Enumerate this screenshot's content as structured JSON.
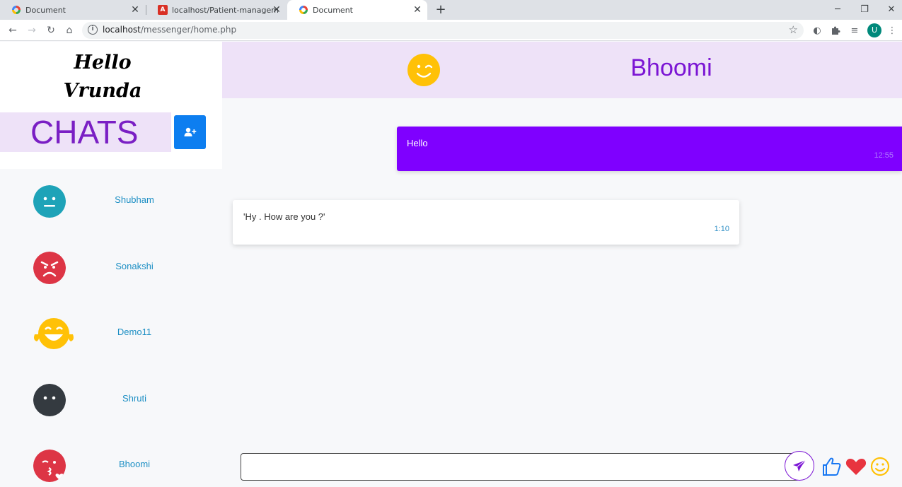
{
  "browser": {
    "tabs": [
      {
        "title": "Document"
      },
      {
        "title": "localhost/Patient-management-s"
      },
      {
        "title": "Document"
      }
    ],
    "url_host": "localhost",
    "url_path": "/messenger/home.php",
    "profile_initial": "U"
  },
  "sidebar": {
    "greeting_line1": "Hello",
    "greeting_line2": "Vrunda",
    "chats_title": "CHATS",
    "contacts": [
      {
        "name": "Shubham",
        "emoji": "neutral-face-icon",
        "color": "#1ea3b8"
      },
      {
        "name": "Sonakshi",
        "emoji": "angry-face-icon",
        "color": "#dd3545"
      },
      {
        "name": "Demo11",
        "emoji": "tears-of-joy-icon",
        "color": "#ffc107"
      },
      {
        "name": "Shruti",
        "emoji": "no-mouth-face-icon",
        "color": "#343a40"
      },
      {
        "name": "Bhoomi",
        "emoji": "kissing-face-icon",
        "color": "#dd3545"
      }
    ]
  },
  "chat": {
    "contact_name": "Bhoomi",
    "header_emoji": "winking-face-icon",
    "messages": [
      {
        "text": "Hello",
        "time": "12:55",
        "direction": "sent"
      },
      {
        "text": "'Hy . How are you ?'",
        "time": "1:10",
        "direction": "received"
      }
    ],
    "input_placeholder": "",
    "reactions": [
      "thumbs-up-icon",
      "heart-icon",
      "smile-icon"
    ]
  },
  "colors": {
    "accent_purple": "#7f00ff",
    "header_bg": "#eee2f8",
    "link_blue": "#1d8fc4",
    "button_blue": "#0d7ef0"
  }
}
